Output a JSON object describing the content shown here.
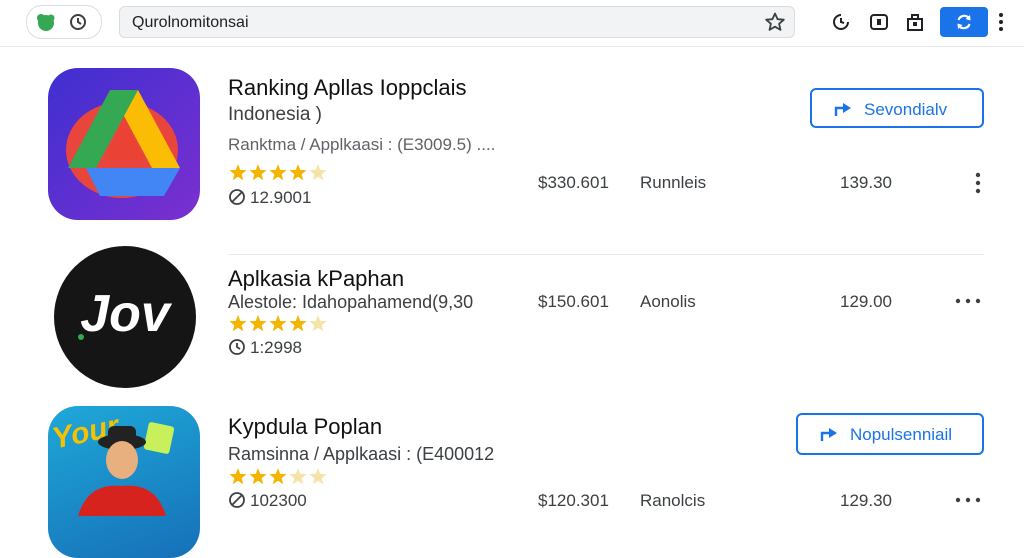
{
  "browser": {
    "url": "Qurolnomitonsai",
    "icons": [
      "app-logo-icon",
      "reload-icon",
      "bookmark-star-icon",
      "history-icon",
      "picture-in-picture-icon",
      "extensions-icon",
      "sync-icon",
      "more-vert-icon"
    ],
    "accent": "#1a73e8"
  },
  "apps": [
    {
      "title": "Ranking Apllas Ioppclais",
      "subtitle": "Indonesia )",
      "meta": "Ranktma / Applkaasi : (E3009.5) ....",
      "rating": 4,
      "count": "12.9001",
      "count_icon": "download-icon",
      "price": "$330.601",
      "category": "Runnleis",
      "number": "139.30",
      "button_label": "Sevondialv",
      "button_icon": "share-arrow-icon",
      "more_icon": "more-vert-icon"
    },
    {
      "title": "Aplkasia kPaphan",
      "subtitle": "Alestole: Idahopahamend(9,30",
      "rating": 4,
      "count": "1:2998",
      "count_icon": "clock-icon",
      "price": "$150.601",
      "category": "Aonolis",
      "number": "129.00",
      "more_icon": "more-horiz-icon",
      "logo_text": "Jov"
    },
    {
      "title": "Kypdula Poplan",
      "subtitle": "Ramsinna / Applkaasi : (E400012",
      "rating": 3,
      "count": "102300",
      "count_icon": "download-icon",
      "price": "$120.301",
      "category": "Ranolcis",
      "number": "129.30",
      "button_label": "Nopulsenniail",
      "button_icon": "share-arrow-icon",
      "more_icon": "more-horiz-icon",
      "logo_text": "Your"
    }
  ]
}
